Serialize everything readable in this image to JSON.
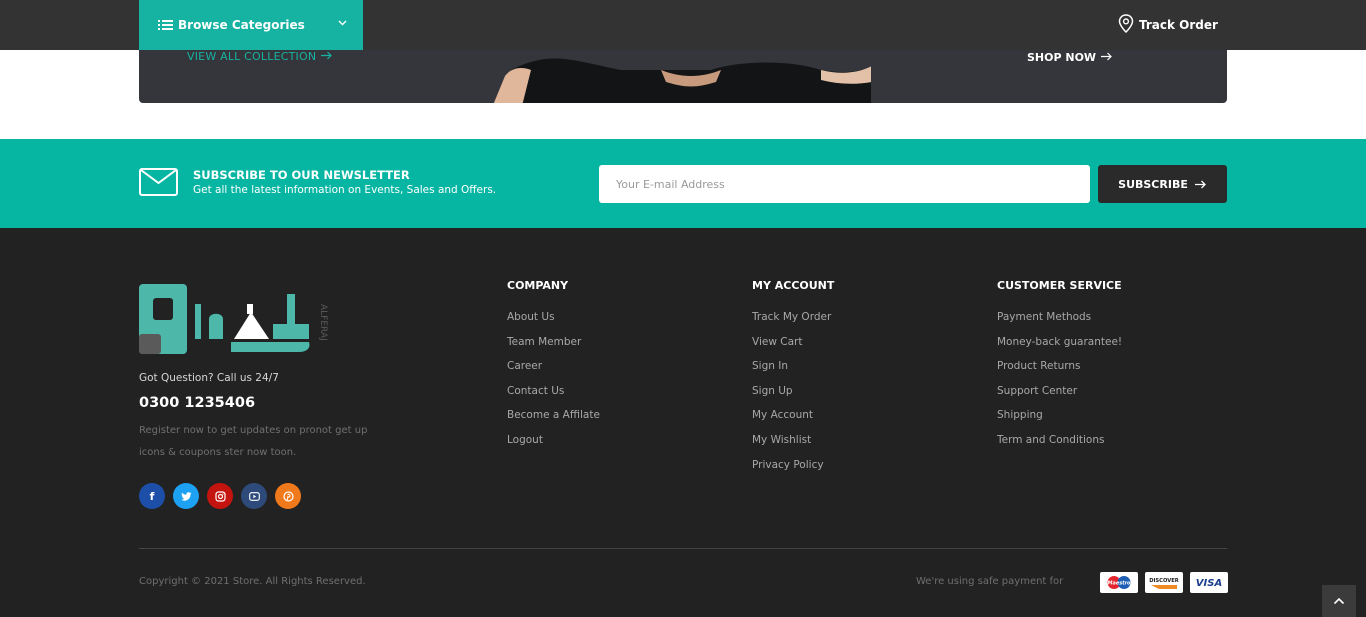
{
  "header": {
    "browse_label": "Browse Categories",
    "track_label": "Track Order"
  },
  "banner": {
    "view_all": "VIEW ALL COLLECTION",
    "shop_now": "SHOP NOW"
  },
  "newsletter": {
    "title": "SUBSCRIBE TO OUR NEWSLETTER",
    "subtitle": "Get all the latest information on Events, Sales and Offers.",
    "placeholder": "Your E-mail Address",
    "button": "SUBSCRIBE"
  },
  "footer": {
    "logo_text": "ALFERAJ",
    "got_question": "Got Question? Call us 24/7",
    "phone": "0300 1235406",
    "register": "Register now to get updates on pronot get up icons & coupons ster now toon.",
    "socials": [
      {
        "name": "facebook-icon",
        "glyph": "f",
        "color": "#1e4fa8"
      },
      {
        "name": "twitter-icon",
        "glyph": "t",
        "color": "#1da1f2"
      },
      {
        "name": "instagram-icon",
        "glyph": "◎",
        "color": "#c4140f"
      },
      {
        "name": "youtube-icon",
        "glyph": "▶",
        "color": "#2e4a7a"
      },
      {
        "name": "pinterest-icon",
        "glyph": "p",
        "color": "#f07a1b"
      }
    ],
    "columns": [
      {
        "title": "COMPANY",
        "items": [
          "About Us",
          "Team Member",
          "Career",
          "Contact Us",
          "Become a Affilate",
          "Logout"
        ]
      },
      {
        "title": "MY ACCOUNT",
        "items": [
          "Track My Order",
          "View Cart",
          "Sign In",
          "Sign Up",
          "My Account",
          "My Wishlist",
          "Privacy Policy"
        ]
      },
      {
        "title": "CUSTOMER SERVICE",
        "items": [
          "Payment Methods",
          "Money-back guarantee!",
          "Product Returns",
          "Support Center",
          "Shipping",
          "Term and Conditions"
        ]
      }
    ],
    "copyright": "Copyright © 2021 Store. All Rights Reserved.",
    "safe_payment": "We're using safe payment for",
    "cards": [
      "Maestro",
      "DISCOVER",
      "VISA"
    ]
  }
}
